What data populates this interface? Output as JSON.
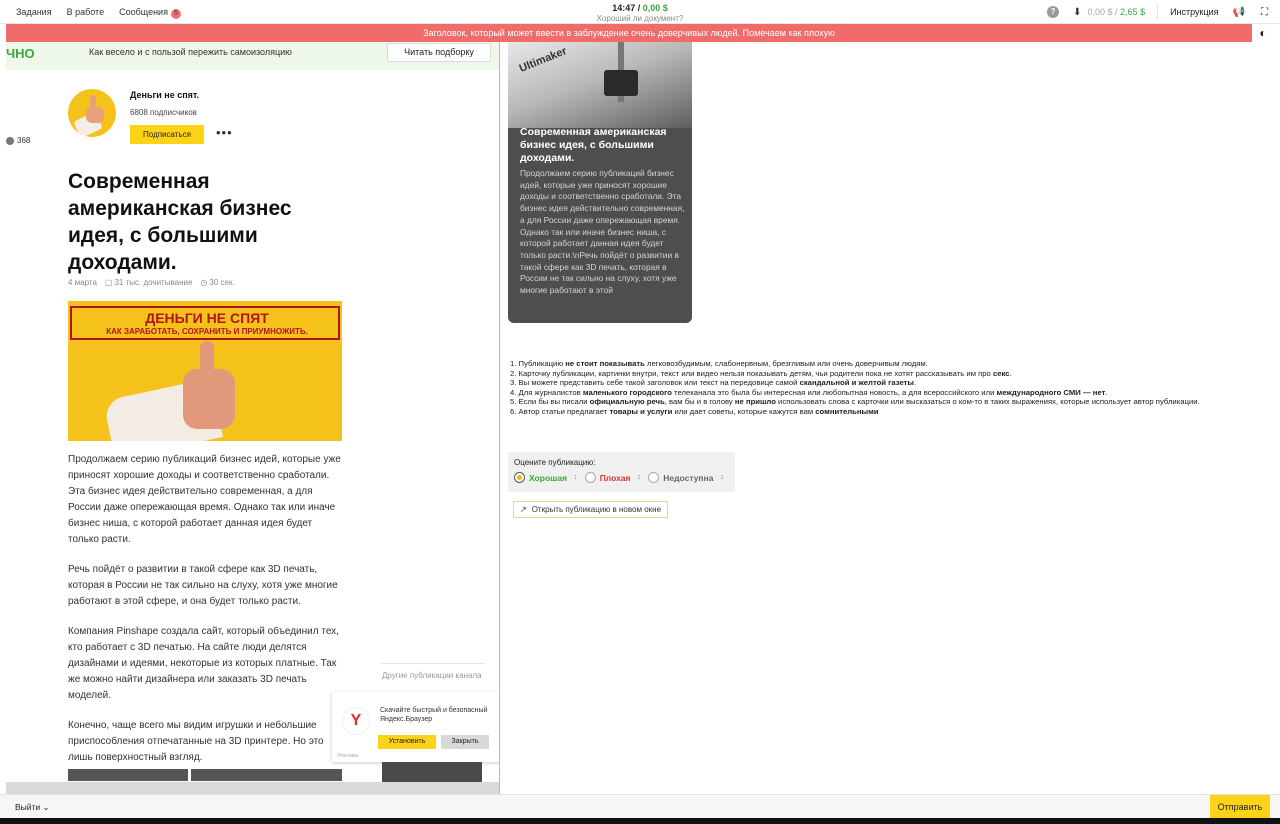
{
  "topbar": {
    "nav": [
      "Задания",
      "В работе",
      "Сообщения"
    ],
    "messages_badge": "5",
    "time": "14:47",
    "earned": "0,00 $",
    "subtitle": "Хороший ли документ?",
    "balance_current": "0,00 $",
    "balance_total": "2,65 $",
    "instruction": "Инструкция"
  },
  "warning": "Заголовок, который может ввести в заблуждение очень доверчивых людей. Помечаем как плохую",
  "article": {
    "banner_logo": "ЧНО",
    "banner_text": "Как весело и с пользой пережить самоизоляцию",
    "banner_button": "Читать подборку",
    "side_count": "368",
    "channel_name": "Деньги не спят.",
    "subscribers": "6808 подписчиков",
    "subscribe_label": "Подписаться",
    "more_dots": "•••",
    "title": "Современная американская бизнес идея, с большими доходами.",
    "date": "4 марта",
    "reads": "31 тыс. дочитывание",
    "read_time": "30 сек.",
    "cover_title": "ДЕНЬГИ НЕ СПЯТ",
    "cover_subtitle": "КАК ЗАРАБОТАТЬ, СОХРАНИТЬ И ПРИУМНОЖИТЬ.",
    "paragraphs": [
      "Продолжаем серию публикаций бизнес идей, которые уже приносят хорошие доходы и соответственно сработали. Эта бизнес идея действительно современная, а для России даже опережающая время. Однако так или иначе бизнес ниша, с которой работает данная идея будет только расти.",
      "Речь пойдёт о развитии в такой сфере как 3D печать, которая в России не так сильно на слуху, хотя уже многие работают в этой сфере, и она будет только расти.",
      "Компания Pinshape создала сайт, который объединил тех, кто работает с 3D печатью. На сайте люди делятся дизайнами и идеями, некоторые из которых платные. Так же можно найти дизайнера или заказать 3D печать моделей.",
      "Конечно, чаще всего мы видим игрушки и небольшие приспособления отпечатанные на 3D принтере. Но это лишь поверхностный взгляд."
    ],
    "other_pubs": "Другие публикации канала"
  },
  "ad": {
    "logo": "Y",
    "text": "Скачайте быстрый и безопасный Яндекс.Браузер",
    "install": "Установить",
    "close": "Закрыть",
    "label": "Реклама"
  },
  "card": {
    "brand": "Ultimaker",
    "title": "Современная американская бизнес идея, с большими доходами.",
    "text": "Продолжаем серию публикаций бизнес идей, которые уже приносят хорошие доходы и соответственно сработали. Эта бизнес идея действительно современная, а для России даже опережающая время. Однако так или иначе бизнес ниша, с которой работает данная идея будет только расти.\\nРечь пойдёт о развитии в такой сфере как 3D печать, которая в России не так сильно на слуху, хотя уже многие работают в этой"
  },
  "rules": [
    {
      "pre": "1. Публикацию ",
      "b1": "не стоит показывать",
      "mid": " легковозбудимым, слабонервным, брезгливым или очень доверчивым людям.",
      "b2": "",
      "post": ""
    },
    {
      "pre": "2. Карточку публикации, картинки внутри, текст или видео нельзя показывать детям, чьи родители пока не хотят рассказывать им про ",
      "b1": "секс",
      "mid": ".",
      "b2": "",
      "post": ""
    },
    {
      "pre": "3. Вы можете представить себе такой заголовок или текст на передовице самой ",
      "b1": "скандальной и желтой газеты",
      "mid": ".",
      "b2": "",
      "post": ""
    },
    {
      "pre": "4. Для журналистов ",
      "b1": "маленького городского",
      "mid": " телеканала это была бы интересная или любопытная новость, а для всероссийского или ",
      "b2": "международного СМИ — нет",
      "post": "."
    },
    {
      "pre": "5. Если бы вы писали ",
      "b1": "официальную речь",
      "mid": ", вам бы и в голову ",
      "b2": "не пришло",
      "post": " использовать слова с карточки или высказаться о ком-то в таких выражениях, которые использует автор публикации."
    },
    {
      "pre": "6. Автор статьи предлагает ",
      "b1": "товары и услуги",
      "mid": " или дает советы, которые кажутся вам ",
      "b2": "сомнительными",
      "post": ""
    }
  ],
  "rating": {
    "question": "Оцените публикацию:",
    "options": [
      {
        "label": "Хорошая",
        "hotkey": "1",
        "checked": true
      },
      {
        "label": "Плохая",
        "hotkey": "2",
        "checked": false
      },
      {
        "label": "Недоступна",
        "hotkey": "3",
        "checked": false
      }
    ]
  },
  "open_new": "Открыть публикацию в новом окне",
  "bottom": {
    "exit": "Выйти",
    "submit": "Отправить"
  }
}
